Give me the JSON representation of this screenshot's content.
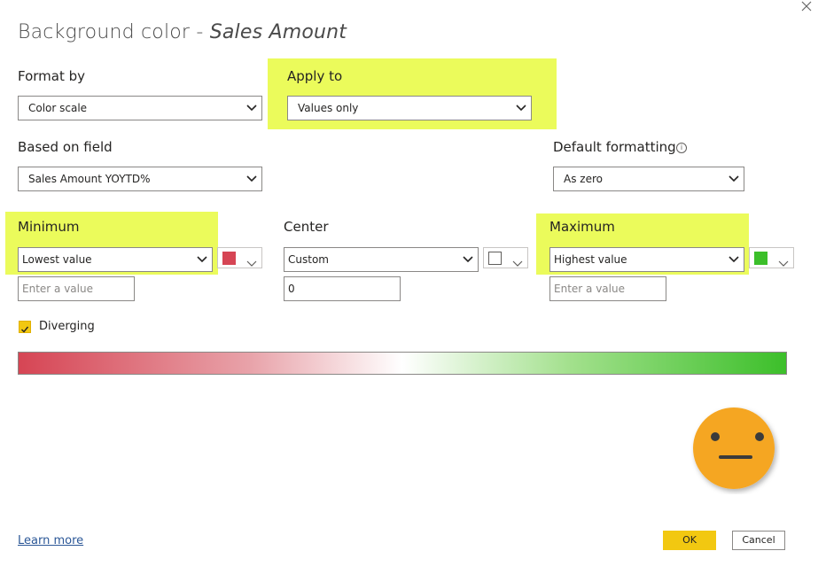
{
  "dialog": {
    "title_prefix": "Background color - ",
    "title_field": "Sales Amount",
    "close_icon": "close-icon"
  },
  "format_by": {
    "label": "Format by",
    "value": "Color scale"
  },
  "apply_to": {
    "label": "Apply to",
    "value": "Values only"
  },
  "based_on_field": {
    "label": "Based on field",
    "value": "Sales Amount YOYTD%"
  },
  "default_formatting": {
    "label": "Default formatting",
    "value": "As zero",
    "info_icon": "info-icon"
  },
  "minimum": {
    "label": "Minimum",
    "value": "Lowest value",
    "placeholder": "Enter a value",
    "color": "#d64554"
  },
  "center": {
    "label": "Center",
    "value": "Custom",
    "input_value": "0",
    "color": "#ffffff"
  },
  "maximum": {
    "label": "Maximum",
    "value": "Highest value",
    "placeholder": "Enter a value",
    "color": "#3cbf2a"
  },
  "diverging": {
    "label": "Diverging",
    "checked": true
  },
  "gradient": {
    "colors": [
      "#d64554",
      "#ffffff",
      "#3cbf2a"
    ]
  },
  "highlight_color": "#ebfb5b",
  "footer": {
    "learn_more": "Learn more",
    "ok": "OK",
    "cancel": "Cancel"
  },
  "emoji": {
    "icon": "neutral-face-icon"
  }
}
